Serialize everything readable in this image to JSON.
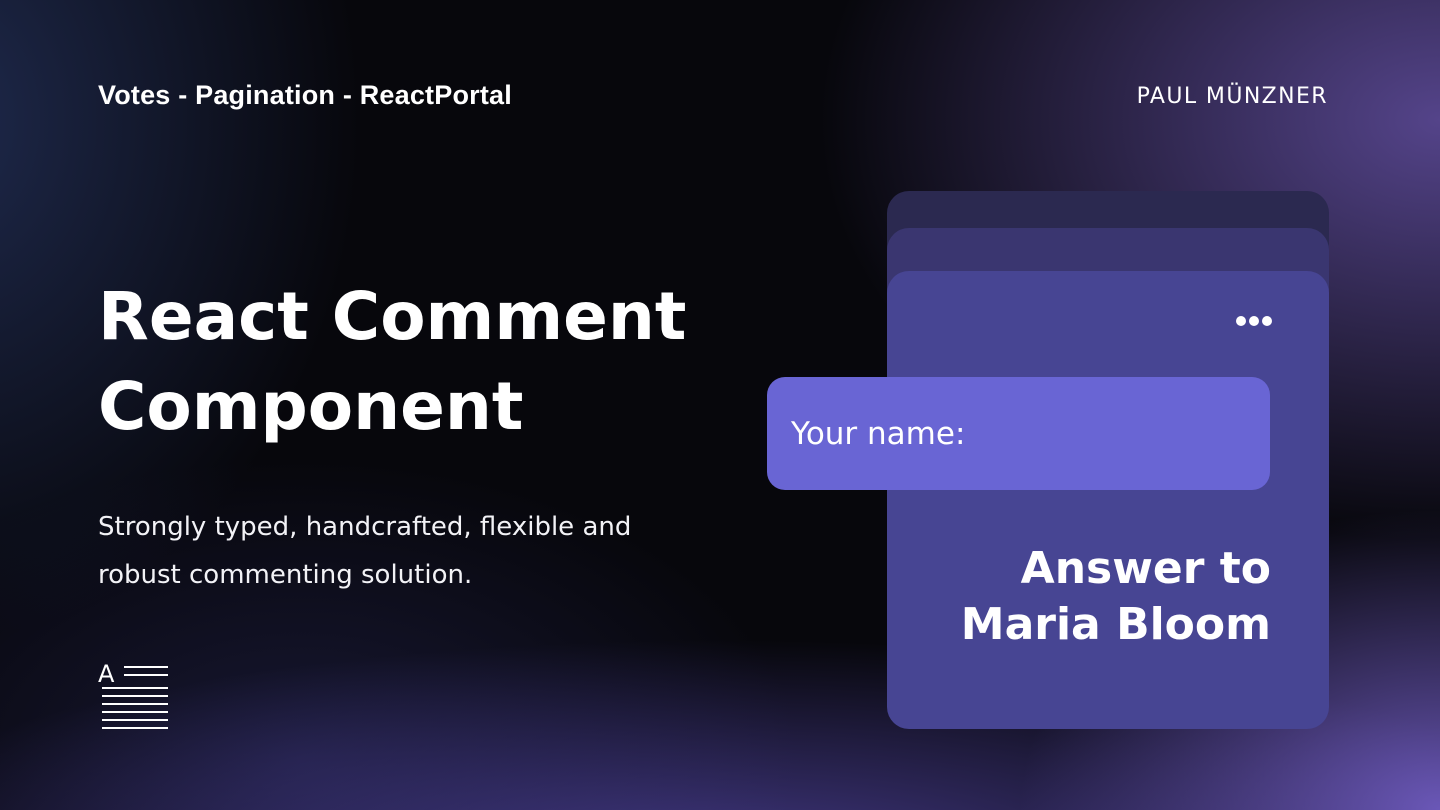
{
  "header": {
    "topics": "Votes - Pagination - ReactPortal",
    "author": "PAUL MÜNZNER"
  },
  "hero": {
    "title_line1": "React Comment",
    "title_line2": "Component",
    "description_line1": "Strongly typed, handcrafted, flexible and",
    "description_line2": "robust commenting solution."
  },
  "icons": {
    "document": "document-text-icon",
    "more": "more-horizontal-icon"
  },
  "comment_card": {
    "name_label": "Your name:",
    "reply_line1": "Answer to",
    "reply_line2": "Maria Bloom"
  },
  "colors": {
    "background": "#07070c",
    "card_back": "#2b2950",
    "card_middle": "#3a3670",
    "card_front": "#474593",
    "input": "#6965d4",
    "text": "#ffffff"
  }
}
